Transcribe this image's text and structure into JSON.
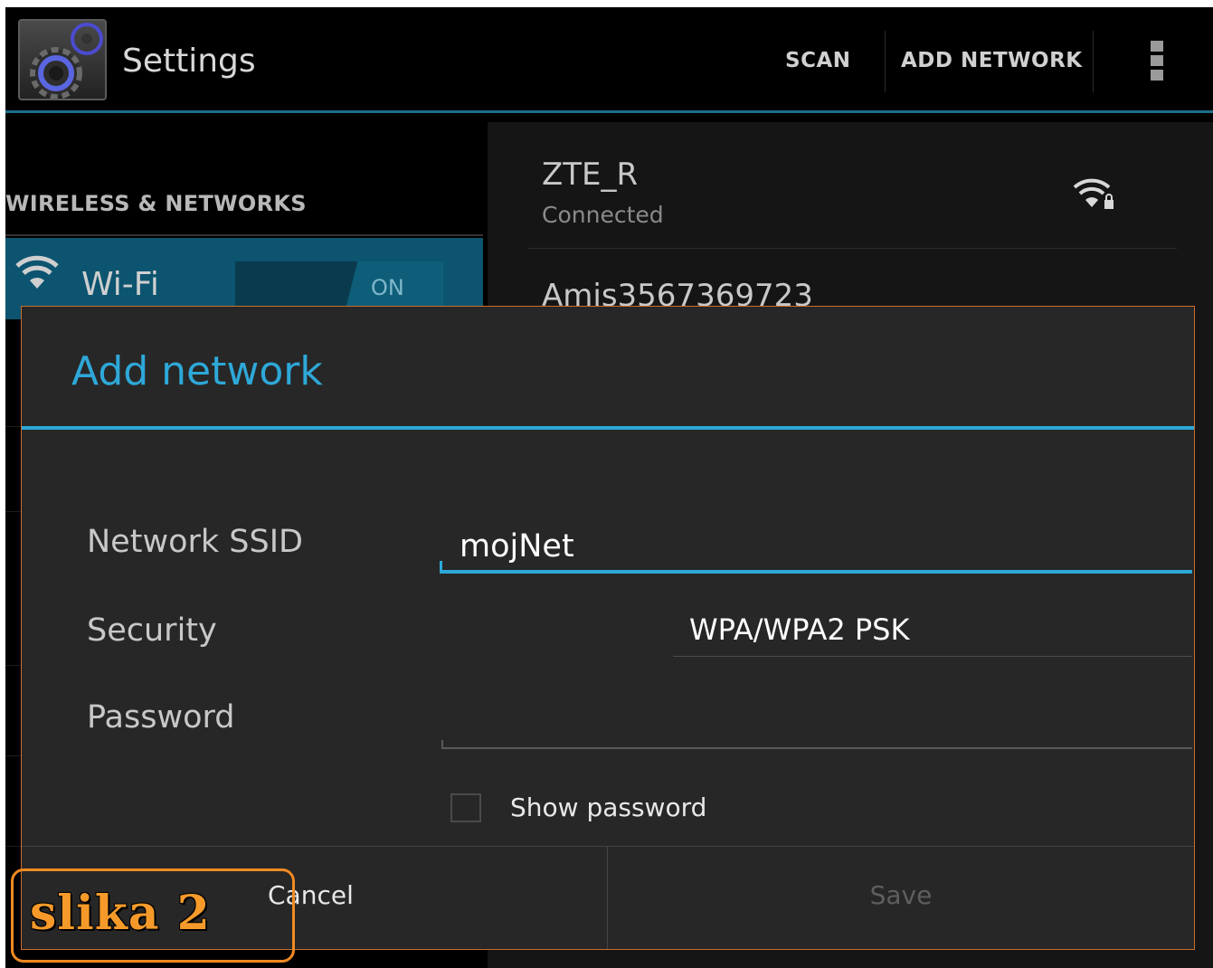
{
  "action_bar": {
    "title": "Settings",
    "actions": {
      "scan": "SCAN",
      "add_network": "ADD NETWORK"
    },
    "overflow_icon": "overflow-menu-icon"
  },
  "left_pane": {
    "section_header": "WIRELESS & NETWORKS",
    "wifi": {
      "label": "Wi-Fi",
      "toggle": "ON"
    }
  },
  "networks": [
    {
      "name": "ZTE_R",
      "status": "Connected",
      "secured": true
    },
    {
      "name": "Amis3567369723"
    }
  ],
  "dialog": {
    "title": "Add network",
    "fields": {
      "ssid": {
        "label": "Network SSID",
        "value": "mojNet"
      },
      "security": {
        "label": "Security",
        "value": "WPA/WPA2 PSK"
      },
      "password": {
        "label": "Password",
        "value": ""
      }
    },
    "show_password": {
      "label": "Show password",
      "checked": false
    },
    "buttons": {
      "cancel": "Cancel",
      "save": "Save"
    }
  },
  "annotation": {
    "text": "slika 2",
    "color": "#f08a22"
  },
  "colors": {
    "accent": "#2ea8d8",
    "wifi_row": "#0c5470",
    "background": "#000000"
  }
}
